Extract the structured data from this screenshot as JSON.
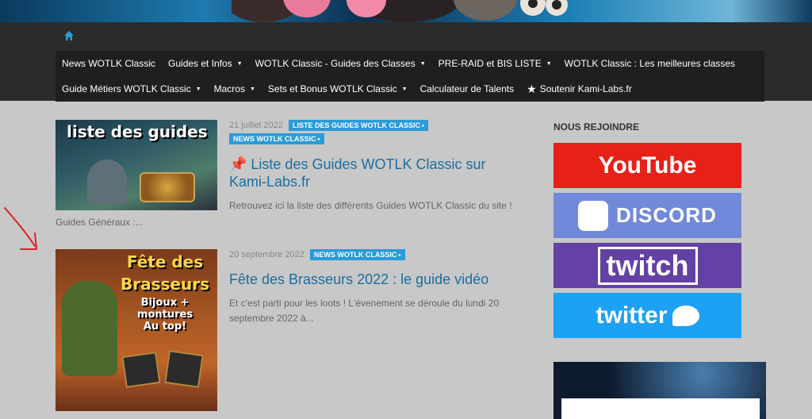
{
  "nav": {
    "home_icon": "home-icon",
    "row1": [
      {
        "label": "News WOTLK Classic",
        "caret": false
      },
      {
        "label": "Guides et Infos",
        "caret": true
      },
      {
        "label": "WOTLK Classic - Guides des Classes",
        "caret": true
      },
      {
        "label": "PRE-RAID et BIS LISTE",
        "caret": true
      },
      {
        "label": "WOTLK Classic : Les meilleures classes",
        "caret": false
      }
    ],
    "row2": [
      {
        "label": "Guide Métiers WOTLK Classic",
        "caret": true
      },
      {
        "label": "Macros",
        "caret": true
      },
      {
        "label": "Sets et Bonus WOTLK Classic",
        "caret": true
      },
      {
        "label": "Calculateur de Talents",
        "caret": false
      },
      {
        "label": "Soutenir Kami-Labs.fr",
        "caret": false,
        "icon": "star-icon"
      }
    ]
  },
  "posts": [
    {
      "thumb_text": "liste des guides",
      "date": "21 juillet 2022",
      "tags": [
        "LISTE DES GUIDES WOTLK CLASSIC",
        "NEWS WOTLK CLASSIC"
      ],
      "title": "📌 Liste des Guides WOTLK Classic sur Kami-Labs.fr",
      "excerpt_a": "Retrouvez ici la liste des différents Guides WOTLK Classic du site !",
      "excerpt_b": "Guides Généraux :..."
    },
    {
      "thumb_text": [
        "Fête des",
        "Brasseurs",
        "Bijoux +",
        "montures",
        "Au top!"
      ],
      "date": "20 septembre 2022",
      "tags": [
        "NEWS WOTLK CLASSIC"
      ],
      "title": "Fête des Brasseurs 2022 : le guide vidéo",
      "excerpt_a": "Et c'est parti pour les loots ! L'évenement se déroule du lundi 20 septembre 2022 à..."
    }
  ],
  "sidebar": {
    "title": "NOUS REJOINDRE",
    "socials": [
      {
        "name": "YouTube",
        "bg": "#e62117"
      },
      {
        "name": "DISCORD",
        "bg": "#7289da"
      },
      {
        "name": "twitch",
        "bg": "#6441a4"
      },
      {
        "name": "twitter",
        "bg": "#1da1f2"
      }
    ]
  },
  "colors": {
    "accent": "#2a9bd8",
    "link": "#1a6ea0"
  }
}
